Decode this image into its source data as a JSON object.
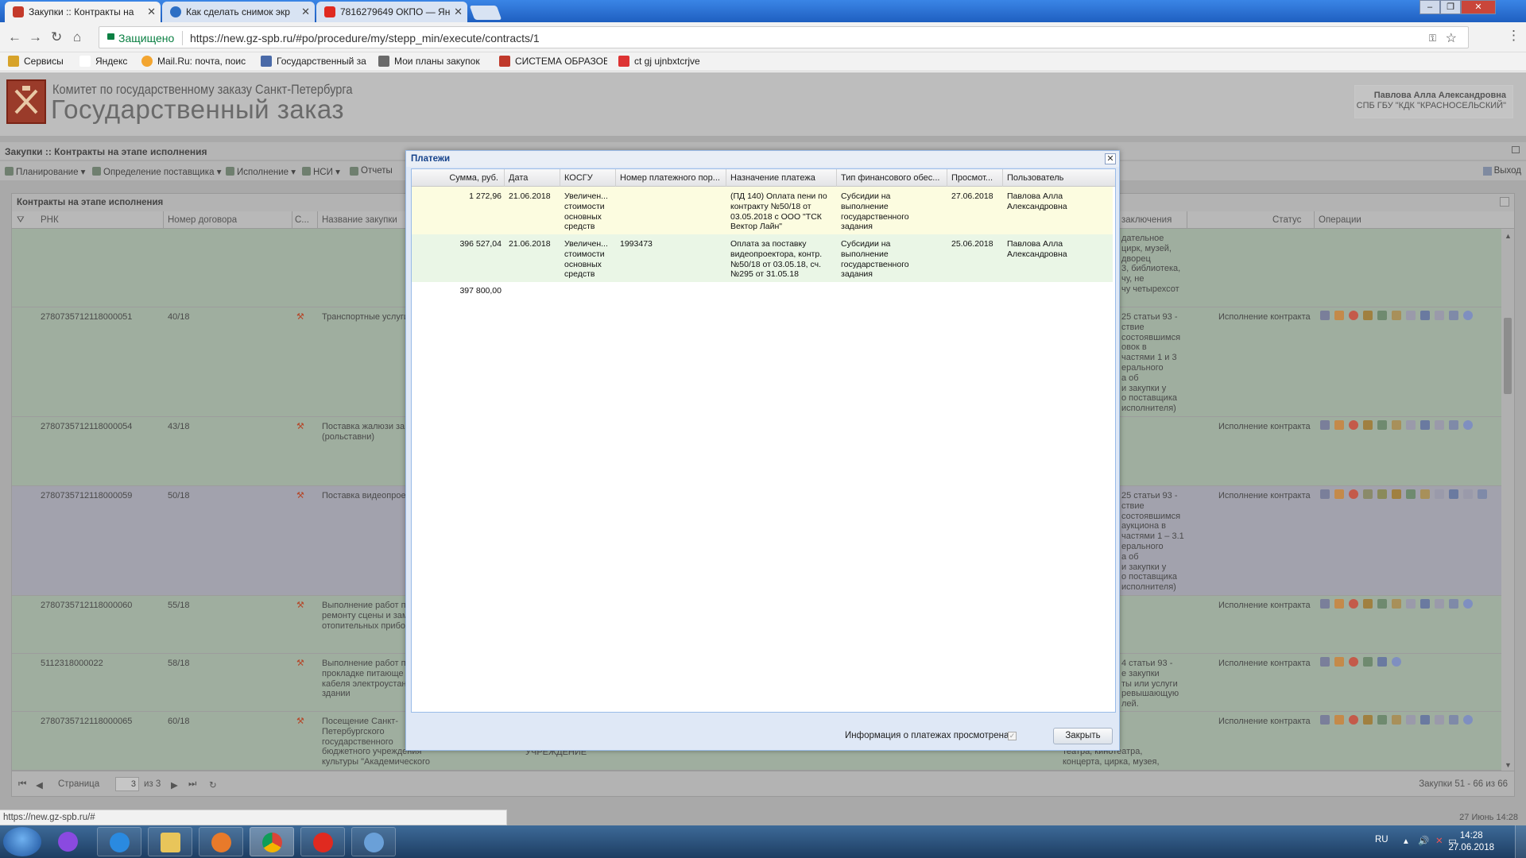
{
  "browser": {
    "tabs": [
      {
        "label": "Закупки :: Контракты на",
        "active": true
      },
      {
        "label": "Как сделать снимок экр",
        "active": false
      },
      {
        "label": "7816279649 ОКПО — Ян",
        "active": false
      }
    ],
    "window_controls": [
      "minimize",
      "restore",
      "close"
    ],
    "secure_label": "Защищено",
    "url": "https://new.gz-spb.ru/#po/procedure/my/stepp_min/execute/contracts/1",
    "bookmarks": [
      {
        "label": "Сервисы",
        "icon": "apps-grid-icon"
      },
      {
        "label": "Яндекс",
        "icon": "yandex-icon"
      },
      {
        "label": "Mail.Ru: почта, поис",
        "icon": "mailru-icon"
      },
      {
        "label": "Государственный за",
        "icon": "gz-icon"
      },
      {
        "label": "Мои планы закупок",
        "icon": "plans-icon"
      },
      {
        "label": "СИСТЕМА ОБРАЗОВ",
        "icon": "system-icon"
      },
      {
        "label": "ct gj ujnbxtcrjve",
        "icon": "gmail-icon"
      }
    ]
  },
  "app": {
    "org_line1": "Комитет по государственному заказу Санкт-Петербурга",
    "org_line2": "Государственный заказ",
    "user_name": "Павлова Алла Александровна",
    "user_org": "СПБ ГБУ \"КДК \"КРАСНОСЕЛЬСКИЙ\"",
    "breadcrumb": "Закупки :: Контракты на этапе исполнения",
    "toolbar": [
      "Планирование",
      "Определение поставщика",
      "Исполнение",
      "НСИ",
      "Отчеты"
    ],
    "exit_label": "Выход",
    "panel_title": "Контракты на этапе исполнения",
    "grid_columns": {
      "rnk": "РНК",
      "contract_no": "Номер договора",
      "s": "С...",
      "name": "Название закупки",
      "basis": "заключения",
      "status": "Статус",
      "ops": "Операции"
    },
    "rows": [
      {
        "rnk": "",
        "no": "",
        "name": "",
        "basis": "дательное\nцирк, музей,\nдворец\n3, библиотека,\nчу, не\nчу четырехсот",
        "status": ""
      },
      {
        "rnk": "2780735712118000051",
        "no": "40/18",
        "name": "Транспортные услуги",
        "basis": "25 статьи 93 -\nствие\nсостоявшимся\nовок в\nчастями 1 и 3\nерального\nа об\nи закупки у\nо поставщика\nисполнителя)",
        "status": "Исполнение контракта"
      },
      {
        "rnk": "2780735712118000054",
        "no": "43/18",
        "name": "Поставка жалюзи за\n(рольставни)",
        "basis": "",
        "status": "Исполнение контракта"
      },
      {
        "rnk": "2780735712118000059",
        "no": "50/18",
        "name": "Поставка видеопрое",
        "basis": "25 статьи 93 -\nствие\nсостоявшимся\nаукциона в\nчастями 1 – 3.1\nерального\nа об\nи закупки у\nо поставщика\nисполнителя)",
        "status": "Исполнение контракта"
      },
      {
        "rnk": "2780735712118000060",
        "no": "55/18",
        "name": "Выполнение работ п\nремонту сцены и зам\nотопительных прибо",
        "basis": "",
        "status": "Исполнение контракта"
      },
      {
        "rnk": "5112318000022",
        "no": "58/18",
        "name": "Выполнение работ п\nпрокладке питающе\nкабеля электроустан\nздании",
        "basis": "4 статьи 93 -\nе закупки\nты или услуги\nревышающую\nлей.",
        "status": "Исполнение контракта"
      },
      {
        "rnk": "2780735712118000065",
        "no": "60/18",
        "name": "Посещение Санкт-\nПетербургского\nгосударственного\nбюджетного учреждения\nкультуры \"Академического",
        "type": "БЮДЖЕТНОЕ\nУЧРЕЖДЕНИЕ",
        "basis": "15 статьи 93 -\nи по\nоопарка,\nтеатра, кинотеатра,\nконцерта, цирка, музея,",
        "status": "Исполнение контракта"
      }
    ],
    "pager": {
      "page_label": "Страница",
      "page": "3",
      "of_label": "из 3",
      "summary": "Закупки 51 - 66 из 66"
    },
    "status_url": "https://new.gz-spb.ru/#",
    "footer_date": "27 Июнь 14:28"
  },
  "modal": {
    "title": "Платежи",
    "columns": [
      "Сумма, руб.",
      "Дата",
      "КОСГУ",
      "Номер платежного пор...",
      "Назначение платежа",
      "Тип финансового обес...",
      "Просмот...",
      "Пользователь"
    ],
    "rows": [
      {
        "amount": "1 272,96",
        "date": "21.06.2018",
        "kosgu": "Увеличен...\nстоимости\nосновных\nсредств",
        "order_no": "",
        "purpose": "(ПД 140) Оплата пени по\nконтракту №50/18 от\n03.05.2018 с ООО \"ТСК\nВектор Лайн\"",
        "finance_type": "Субсидии на\nвыполнение\nгосударственного\nзадания",
        "viewed": "27.06.2018",
        "user": "Павлова Алла\nАлександровна"
      },
      {
        "amount": "396 527,04",
        "date": "21.06.2018",
        "kosgu": "Увеличен...\nстоимости\nосновных\nсредств",
        "order_no": "1993473",
        "purpose": "Оплата за поставку\nвидеопроектора, контр.\n№50/18 от 03.05.18, сч.\n№295 от 31.05.18",
        "finance_type": "Субсидии на\nвыполнение\nгосударственного\nзадания",
        "viewed": "25.06.2018",
        "user": "Павлова Алла\nАлександровна"
      }
    ],
    "total": "397 800,00",
    "viewed_checkbox_label": "Информация о платежах просмотрена",
    "viewed_checked": true,
    "close_button": "Закрыть"
  },
  "taskbar": {
    "apps": [
      "internet-explorer-icon",
      "file-explorer-icon",
      "media-player-icon",
      "chrome-icon",
      "yandex-browser-icon",
      "paint-icon"
    ],
    "active_app": "chrome-icon",
    "lang": "RU",
    "time": "14:28",
    "date": "27.06.2018"
  },
  "colors": {
    "tabbar": "#2a6fd0",
    "secure_green": "#0b8043",
    "overlay_grey": "#a9a9a9",
    "row_green": "#9fae9f",
    "row_purple": "#a2a2ad",
    "modal_border": "#99bbe8",
    "modal_row_yellow": "#fcfce0",
    "modal_row_green": "#eaf6e6"
  }
}
